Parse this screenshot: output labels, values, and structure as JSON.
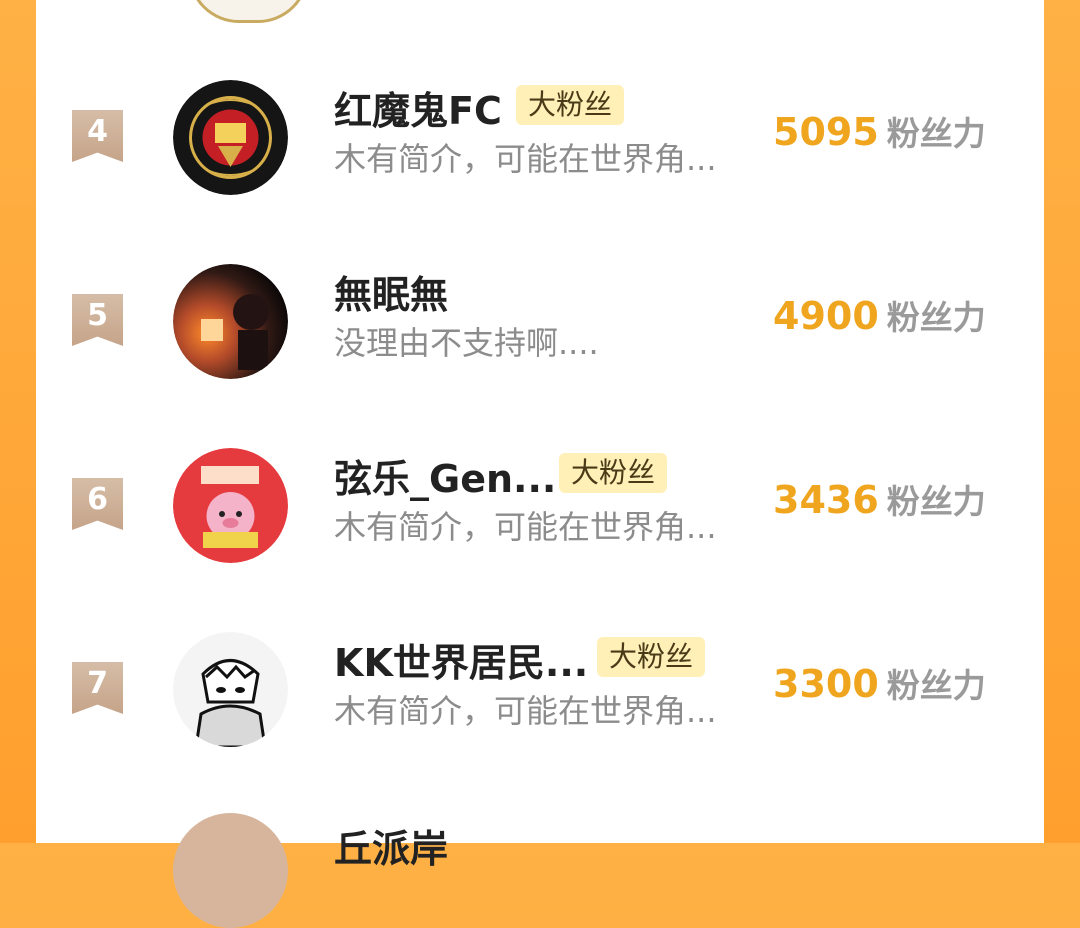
{
  "unit": "粉丝力",
  "badge_text": "大粉丝",
  "items": [
    {
      "rank": "4",
      "name": "红魔鬼FC",
      "badge": "大粉丝",
      "desc": "木有简介，可能在世界角...",
      "power": "5095"
    },
    {
      "rank": "5",
      "name": "無眠無",
      "badge": "",
      "desc": "没理由不支持啊....",
      "power": "4900"
    },
    {
      "rank": "6",
      "name": "弦乐_Gen...",
      "badge": "大粉丝",
      "desc": "木有简介，可能在世界角...",
      "power": "3436"
    },
    {
      "rank": "7",
      "name": "KK世界居民...",
      "badge": "大粉丝",
      "desc": "木有简介，可能在世界角...",
      "power": "3300"
    }
  ],
  "next_item_partial_name": "丘派岸"
}
